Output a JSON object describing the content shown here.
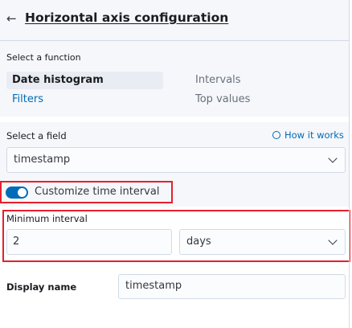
{
  "header": {
    "title": "Horizontal axis configuration",
    "back_icon": "arrow-left-icon"
  },
  "function_section": {
    "label": "Select a function",
    "options": [
      {
        "label": "Date histogram",
        "selected": true
      },
      {
        "label": "Intervals",
        "selected": false
      },
      {
        "label": "Filters",
        "selected": false
      },
      {
        "label": "Top values",
        "selected": false
      }
    ]
  },
  "field_section": {
    "label": "Select a field",
    "help_link": "How it works",
    "help_icon": "question-circle-icon",
    "selected_field": "timestamp"
  },
  "customize_toggle": {
    "label": "Customize time interval",
    "checked": true
  },
  "minimum_interval": {
    "label": "Minimum interval",
    "value": "2",
    "unit": "days"
  },
  "display_name": {
    "label": "Display name",
    "value": "timestamp"
  },
  "colors": {
    "accent": "#006bb8",
    "highlight_border": "#e5202e",
    "panel_bg": "#f5f7fa"
  }
}
